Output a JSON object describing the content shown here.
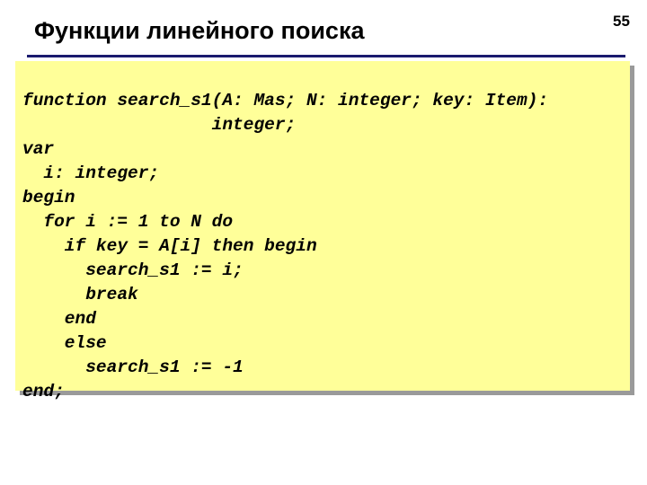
{
  "slide": {
    "title": "Функции линейного поиска",
    "page_number": "55",
    "code_lines": [
      "function search_s1(A: Mas; N: integer; key: Item):",
      "                  integer;",
      "var",
      "  i: integer;",
      "begin",
      "  for i := 1 to N do",
      "    if key = A[i] then begin",
      "      search_s1 := i;",
      "      break",
      "    end",
      "    else",
      "      search_s1 := -1",
      "end;"
    ]
  },
  "colors": {
    "code_background": "#ffff99",
    "rule": "#1a1a6e"
  }
}
